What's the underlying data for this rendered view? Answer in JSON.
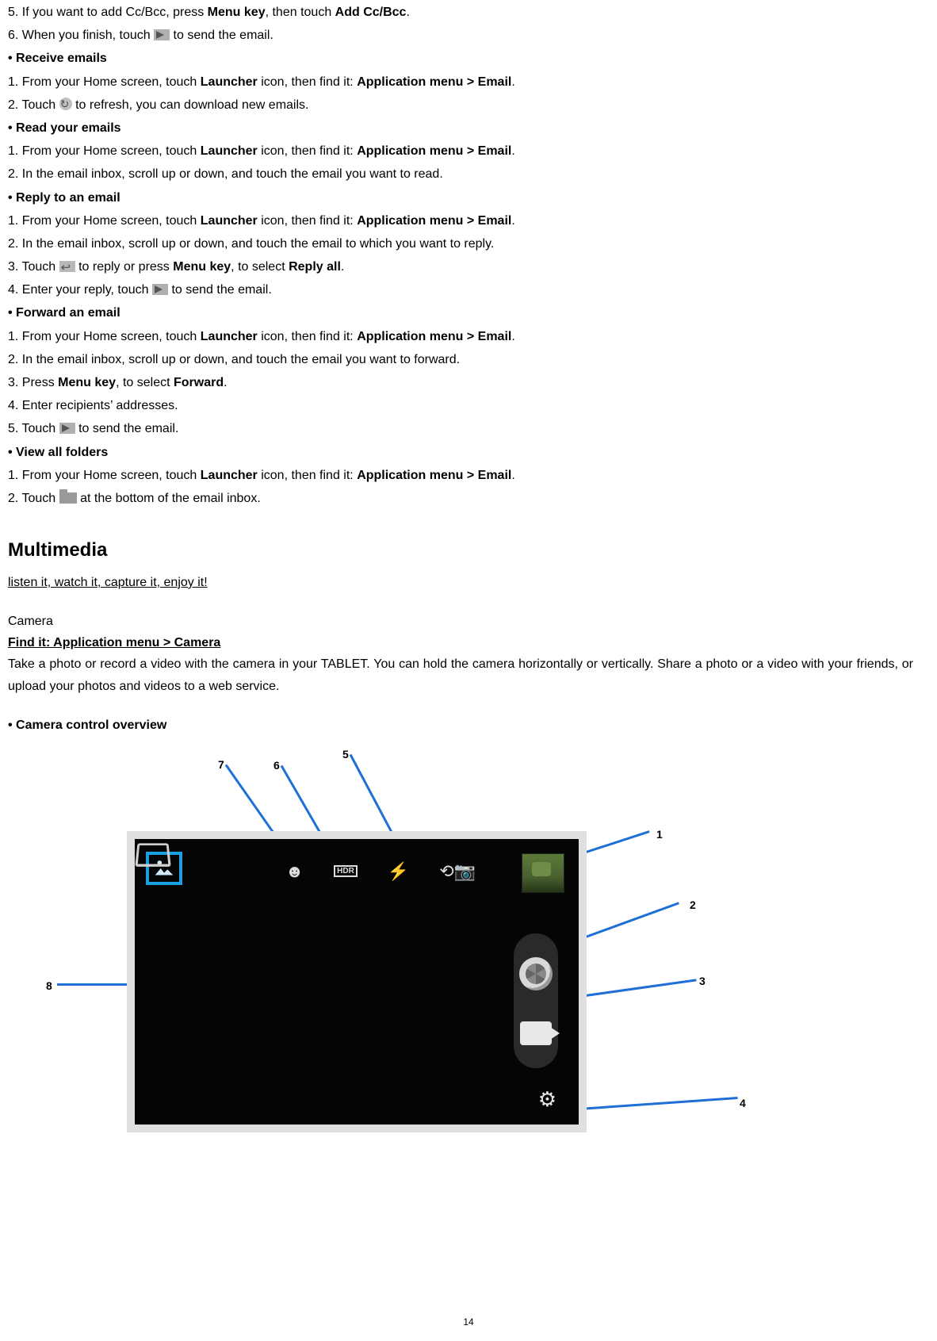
{
  "steps": {
    "s5a": "5. If you want to add Cc/Bcc, press ",
    "s5b": "Menu key",
    "s5c": ", then touch ",
    "s5d": "Add Cc/Bcc",
    "s5e": ".",
    "s6a": "6. When you finish, touch ",
    "s6b": " to send the email."
  },
  "receive": {
    "heading": "Receive emails",
    "l1a": "1. From your Home screen, touch ",
    "l1b": "Launcher",
    "l1c": " icon, then find it: ",
    "l1d": "Application menu > Email",
    "l1e": ".",
    "l2a": "2. Touch ",
    "l2b": " to refresh, you can download new emails."
  },
  "read": {
    "heading": "Read your emails",
    "l1a": "1. From your Home screen, touch ",
    "l1b": "Launcher",
    "l1c": " icon, then find it: ",
    "l1d": "Application menu > Email",
    "l1e": ".",
    "l2": "2. In the email inbox, scroll up or down, and touch the email you want to read."
  },
  "reply": {
    "heading": "Reply to an email",
    "l1a": "1. From your Home screen, touch ",
    "l1b": "Launcher",
    "l1c": " icon, then find it: ",
    "l1d": "Application menu > Email",
    "l1e": ".",
    "l2": "2. In the email inbox, scroll up or down, and touch the email to which you want to reply.",
    "l3a": "3. Touch ",
    "l3b": " to reply or press ",
    "l3c": "Menu key",
    "l3d": ", to select ",
    "l3e": "Reply all",
    "l3f": ".",
    "l4a": "4. Enter your reply, touch ",
    "l4b": " to send the email."
  },
  "forward": {
    "heading": "Forward an email",
    "l1a": "1. From your Home screen, touch ",
    "l1b": "Launcher",
    "l1c": " icon, then find it: ",
    "l1d": "Application menu > Email",
    "l1e": ".",
    "l2": "2. In the email inbox, scroll up or down, and touch the email you want to forward.",
    "l3a": "3. Press ",
    "l3b": "Menu key",
    "l3c": ", to select ",
    "l3d": "Forward",
    "l3e": ".",
    "l4": "4. Enter recipients’ addresses.",
    "l5a": "5. Touch ",
    "l5b": " to send the email."
  },
  "folders": {
    "heading": "View all folders",
    "l1a": "1. From your Home screen, touch ",
    "l1b": "Launcher",
    "l1c": " icon, then find it: ",
    "l1d": "Application menu > Email",
    "l1e": ".",
    "l2a": "2. Touch ",
    "l2b": " at the bottom of the email inbox."
  },
  "multimedia": {
    "title": "Multimedia",
    "tagline": "listen it, watch it, capture it, enjoy it!",
    "camera_label": "Camera",
    "findit": "Find it: Application menu > Camera",
    "desc": "Take a photo or record a video with the camera in your TABLET. You can hold the camera horizontally or vertically. Share a photo or a video with your friends, or upload your photos and videos to a web service.",
    "overview": "Camera control overview"
  },
  "callouts": {
    "n1": "1",
    "n2": "2",
    "n3": "3",
    "n4": "4",
    "n5": "5",
    "n6": "6",
    "n7": "7",
    "n8": "8"
  },
  "page_number": "14"
}
